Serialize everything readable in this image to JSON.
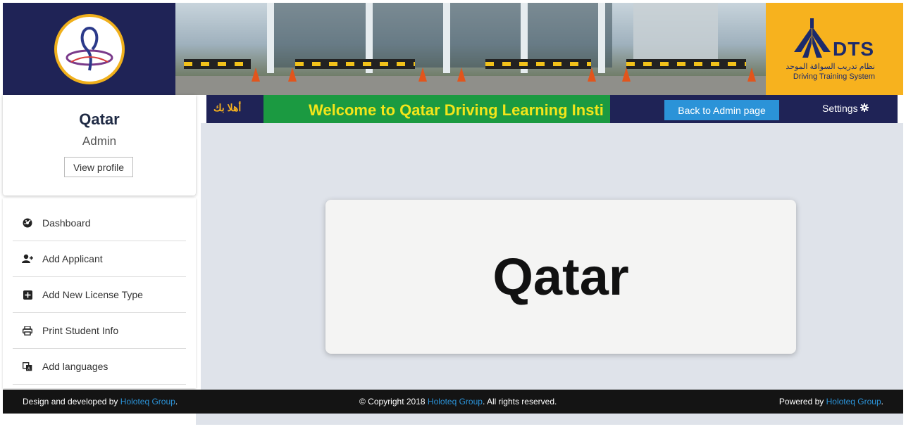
{
  "header": {
    "left_logo_icon": "institute-logo-icon",
    "right_logo": {
      "icon": "dts-logo-icon",
      "brand": "DTS",
      "arabic_name": "نظام تدريب السواقة الموحد",
      "english_name": "Driving Training System"
    }
  },
  "profile": {
    "name": "Qatar",
    "role": "Admin",
    "view_profile_label": "View profile"
  },
  "sidebar": {
    "items": [
      {
        "label": "Dashboard",
        "icon": "dashboard-icon"
      },
      {
        "label": "Add Applicant",
        "icon": "add-user-icon"
      },
      {
        "label": "Add New License Type",
        "icon": "plus-square-icon"
      },
      {
        "label": "Print Student Info",
        "icon": "printer-icon"
      },
      {
        "label": "Add languages",
        "icon": "language-icon"
      }
    ]
  },
  "nav": {
    "greeting": "أهلا بك",
    "marquee_text": "Welcome to Qatar Driving Learning Insti",
    "back_button": "Back to Admin page",
    "settings_label": "Settings",
    "settings_icon": "gear-icon"
  },
  "main": {
    "title": "Qatar"
  },
  "footer": {
    "left_text": "Design and developed by ",
    "left_link": "Holoteq Group",
    "left_suffix": ".",
    "center_text": "© Copyright 2018 ",
    "center_link": "Holoteq Group",
    "center_suffix": ". All rights reserved.",
    "right_text": "Powered by ",
    "right_link": "Holoteq Group",
    "right_suffix": "."
  },
  "colors": {
    "navy": "#1f2356",
    "gold": "#f7b21e",
    "green": "#1b9a41",
    "marquee_text": "#f2e51a",
    "button_blue": "#2b93d8",
    "content_bg": "#dfe3ea",
    "footer_bg": "#141414"
  }
}
